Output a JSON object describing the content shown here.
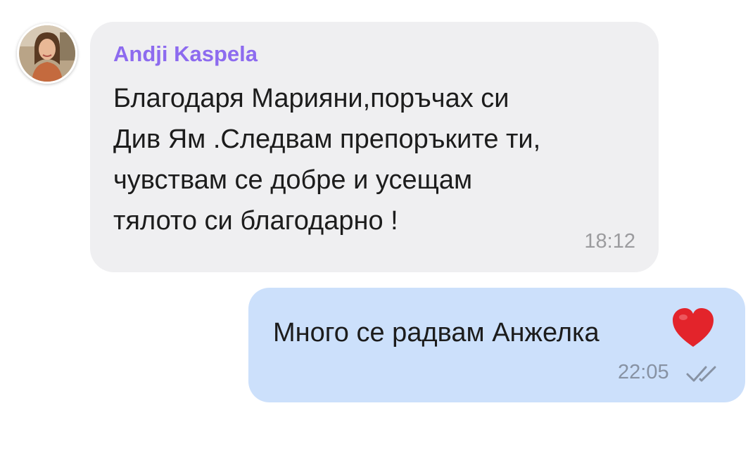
{
  "incoming": {
    "sender_name": "Andji Kaspela",
    "message_lines": [
      "Благодаря Марияни,поръчах си",
      "Див Ям .Следвам препоръките ти,",
      "чувствам се добре и усещам",
      "тялото си благодарно !"
    ],
    "time": "18:12",
    "avatar_icon": "profile-photo"
  },
  "outgoing": {
    "message": "Много се радвам Анжелка",
    "emoji": "heart-icon",
    "time": "22:05",
    "status_icon": "double-check-icon"
  },
  "colors": {
    "sender_name": "#8d6bef",
    "incoming_bubble": "#efeff1",
    "outgoing_bubble": "#cce0fb",
    "heart": "#e3242b"
  }
}
